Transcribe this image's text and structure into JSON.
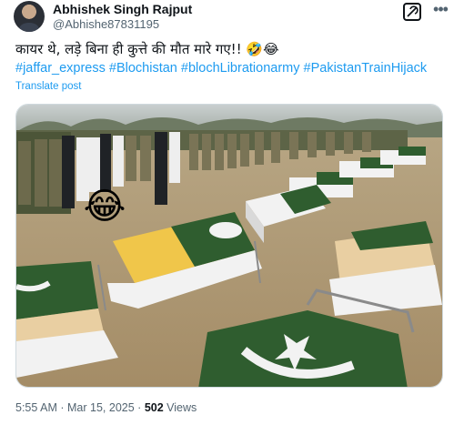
{
  "author": {
    "display_name": "Abhishek Singh Rajput",
    "handle": "@Abhishe87831195"
  },
  "tweet": {
    "text": "कायर थे, लड़े बिना ही कुत्ते की मौत मारे गए!! 🤣😂",
    "hashtags": [
      "#jaffar_express",
      "#Blochistan",
      "#blochLibrationarmy",
      "#PakistanTrainHijack"
    ],
    "translate_label": "Translate post"
  },
  "media": {
    "overlay_emoji": "😂"
  },
  "meta": {
    "time": "5:55 AM",
    "separator": "·",
    "date": "Mar 15, 2025",
    "views_count": "502",
    "views_label": "Views"
  },
  "icons": {
    "grok": "grok-icon",
    "more": "more-icon"
  },
  "colors": {
    "link": "#1d9bf0",
    "secondary_text": "#536471"
  }
}
